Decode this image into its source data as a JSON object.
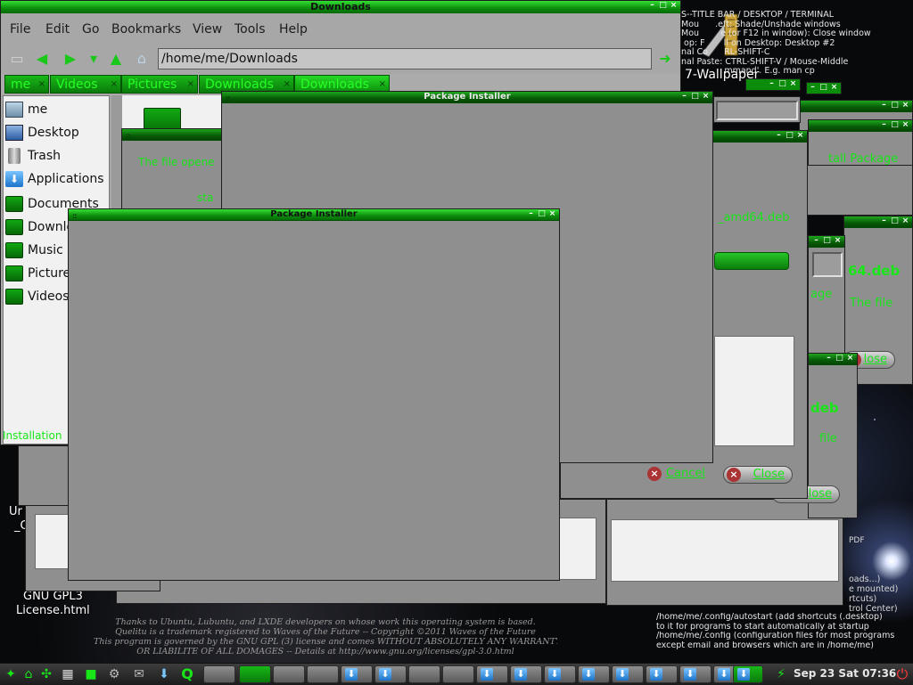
{
  "colors": {
    "accent": "#19e619",
    "titlebar": "#0b8c0b",
    "window_gray": "#8f8f8f"
  },
  "desktop": {
    "notes_top": "S--TITLE BAR / DESKTOP / TERMINAL\nMou      .eft: Shade/Unshade windows\nMou        e (or F12 in window): Close window\n op: F       ll on Desktop: Desktop #2\nnal Co      RL-SHIFT-C\nnal Paste: CTRL-SHIFT-V / Mouse-Middle\n                mmand'. E.g. man cp",
    "wallpaper_label": "7-Wallpaper",
    "pdf_label": "PDF",
    "notes_right_mid": [
      "oads...)",
      "e mounted)",
      "rtcuts)",
      "trol Center)"
    ],
    "notes_bottom": [
      "/home/me/.config/autostart (add shortcuts (.desktop)",
      "to it for programs to start automatically at startup",
      "/home/me/.config (configuration files for most programs",
      "except email and browsers which are in /home/me)"
    ],
    "license_icon_label_top": "Ur",
    "license_icon_label_mid": "_C",
    "license_icon_label": "GNU GPL3",
    "license_icon_label2": "License.html",
    "license_lines": [
      "Thanks to Ubuntu, Lubuntu, and LXDE developers on whose work this operating system is based.",
      "Quelitu is a trademark registered to Waves of the Future  --  Copyright ©2011  Waves of the Future",
      "This program is governed by the GNU GPL (3) license and comes WITHOUT ABSOLUTELY ANY WARRANTY",
      "OR LIABILITE OF ALL DOMAGES -- Details at http://www.gnu.org/licenses/gpl-3.0.html"
    ]
  },
  "file_manager": {
    "title": "Downloads",
    "menu": [
      "File",
      "Edit",
      "Go",
      "Bookmarks",
      "View",
      "Tools",
      "Help"
    ],
    "path": "/home/me/Downloads",
    "tabs": [
      "me",
      "Videos",
      "Pictures",
      "Downloads",
      "Downloads"
    ],
    "places": [
      "me",
      "Desktop",
      "Trash",
      "Applications",
      "Documents",
      "Downloads",
      "Music",
      "Pictures",
      "Videos"
    ],
    "status_text": "Installation"
  },
  "installer_back": {
    "title": "Package Installer",
    "status_text": "The file opene",
    "status_text2": "sta",
    "filename": "_amd64.deb",
    "install_label": "tall Package",
    "cancel_label": "Cancel",
    "close_label": "Close"
  },
  "installer_stack": {
    "deb_label": "64.deb",
    "age_label": "age",
    "file_label": "The file",
    "close_label": "lose",
    "deb_label2": "deb",
    "file_label2": "file",
    "close_label2": "lose"
  },
  "installer_front": {
    "title": "Package Installer"
  },
  "taskbar": {
    "clock": "Sep 23 Sat 07:36"
  }
}
